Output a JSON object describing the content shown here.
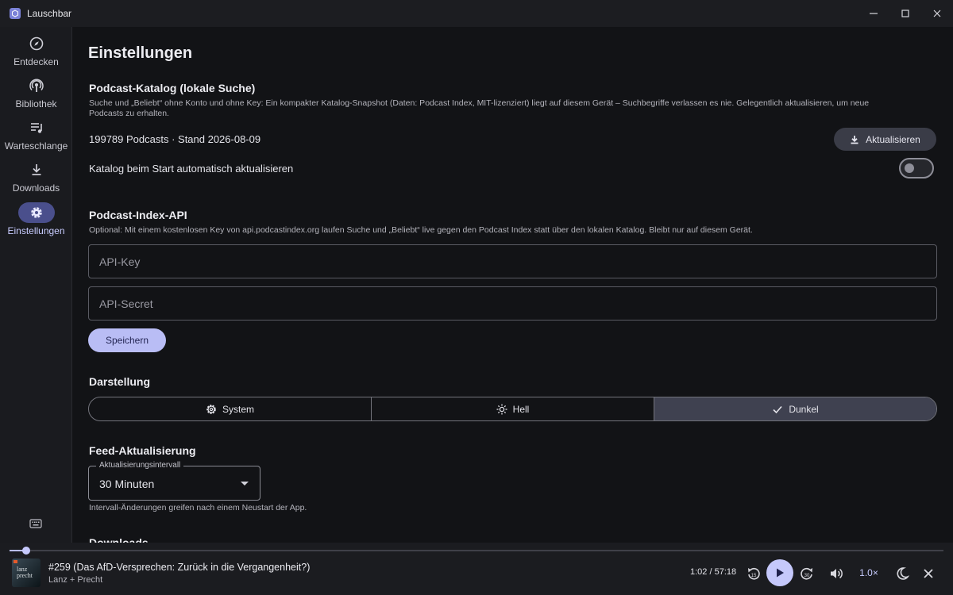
{
  "window": {
    "title": "Lauschbar"
  },
  "sidebar": {
    "items": [
      {
        "label": "Entdecken",
        "icon": "compass-icon",
        "active": false
      },
      {
        "label": "Bibliothek",
        "icon": "podcast-icon",
        "active": false
      },
      {
        "label": "Warteschlange",
        "icon": "queue-icon",
        "active": false
      },
      {
        "label": "Downloads",
        "icon": "download-icon",
        "active": false
      },
      {
        "label": "Einstellungen",
        "icon": "gear-icon",
        "active": true
      }
    ]
  },
  "page": {
    "title": "Einstellungen"
  },
  "catalog": {
    "title": "Podcast-Katalog (lokale Suche)",
    "description_line1": "Suche und „Beliebt“ ohne Konto und ohne Key: Ein kompakter Katalog-Snapshot (Daten: Podcast Index, MIT-lizenziert) liegt auf diesem Gerät – Suchbegriffe verlassen es nie. Gelegentlich aktualisieren, um neue",
    "description_line2": "Podcasts zu erhalten.",
    "status": "199789 Podcasts · Stand 2026-08-09",
    "update_button": "Aktualisieren",
    "auto_update_label": "Katalog beim Start automatisch aktualisieren",
    "auto_update_enabled": false
  },
  "api": {
    "title": "Podcast-Index-API",
    "description": "Optional: Mit einem kostenlosen Key von api.podcastindex.org laufen Suche und „Beliebt“ live gegen den Podcast Index statt über den lokalen Katalog. Bleibt nur auf diesem Gerät.",
    "key_placeholder": "API-Key",
    "key_value": "",
    "secret_placeholder": "API-Secret",
    "secret_value": "",
    "save_button": "Speichern"
  },
  "appearance": {
    "title": "Darstellung",
    "options": [
      {
        "label": "System",
        "icon": "gear-icon",
        "selected": false
      },
      {
        "label": "Hell",
        "icon": "sun-icon",
        "selected": false
      },
      {
        "label": "Dunkel",
        "icon": "check-icon",
        "selected": true
      }
    ]
  },
  "feed": {
    "title": "Feed-Aktualisierung",
    "interval_label": "Aktualisierungsintervall",
    "interval_value": "30 Minuten",
    "hint": "Intervall-Änderungen greifen nach einem Neustart der App."
  },
  "downloads": {
    "title": "Downloads"
  },
  "player": {
    "episode_title": "#259 (Das AfD-Versprechen: Zurück in die Vergangenheit?)",
    "podcast": "Lanz + Precht",
    "cover_text": "lanz\nprecht",
    "time": "1:02 / 57:18",
    "progress": 0.018,
    "speed": "1.0×",
    "colors": {
      "accent": "#c5c8fb",
      "background": "#1b1c20"
    }
  }
}
